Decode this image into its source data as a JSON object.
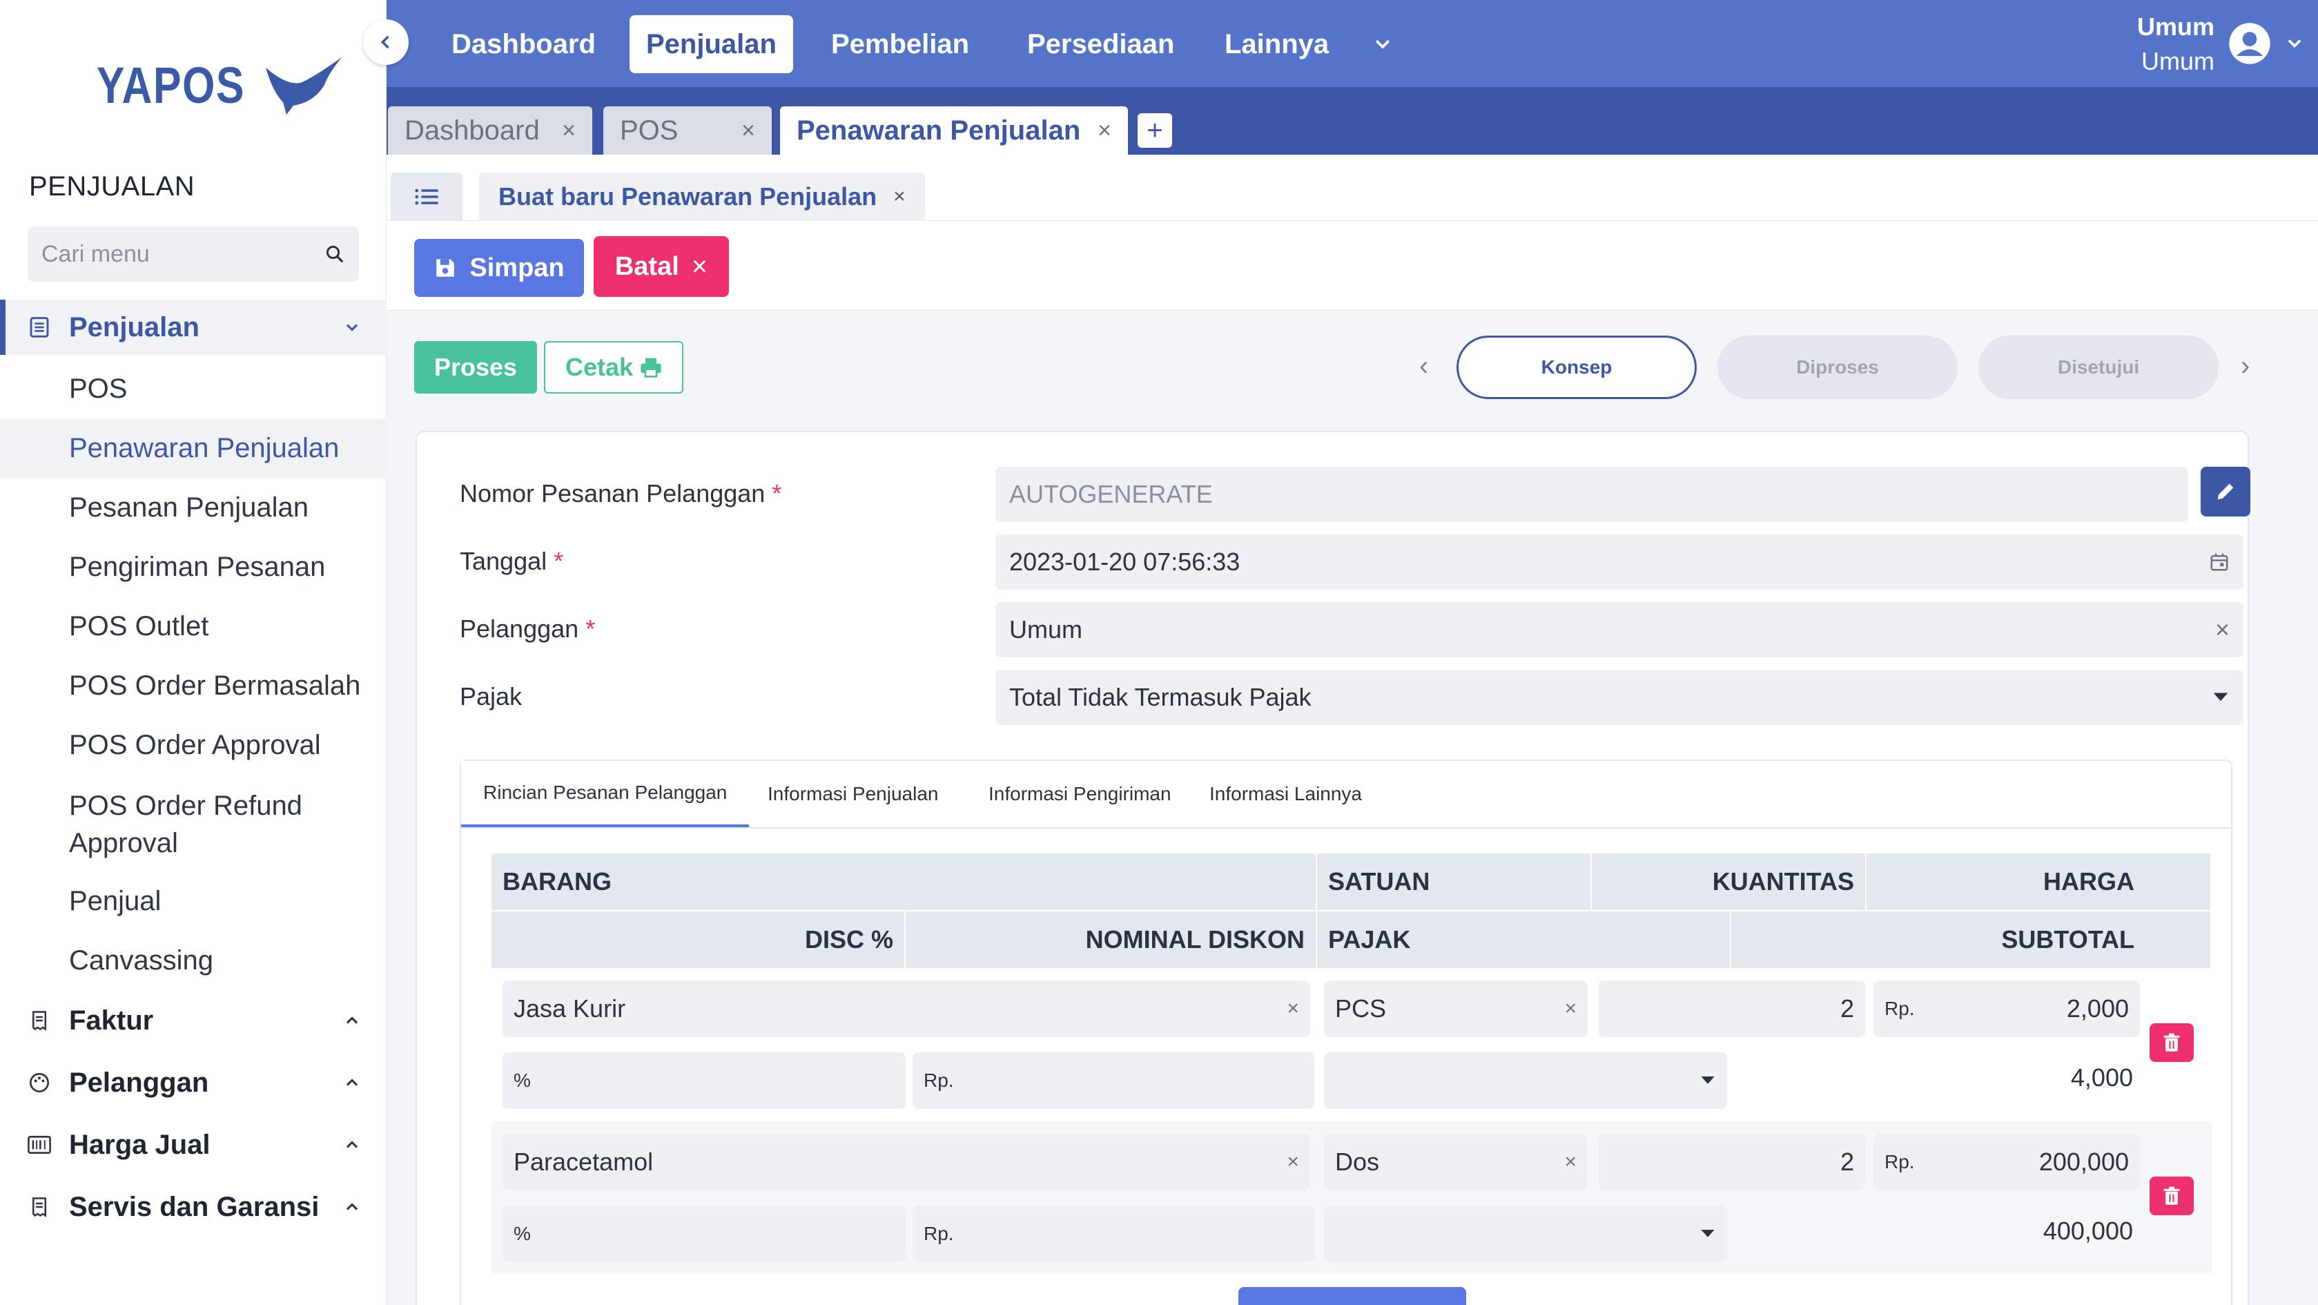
{
  "brand": {
    "name": "YAPOS",
    "color": "#3a5aa8"
  },
  "colors": {
    "primary": "#3b57a6",
    "topbar": "#5474c9",
    "success": "#48c29a",
    "danger": "#ee2f6e",
    "save": "#5877e2"
  },
  "sidebar": {
    "title": "PENJUALAN",
    "search_placeholder": "Cari menu",
    "groups": [
      {
        "label": "Penjualan",
        "icon": "document-list-icon",
        "expanded": true
      },
      {
        "label": "Faktur",
        "icon": "receipt-icon"
      },
      {
        "label": "Pelanggan",
        "icon": "palette-icon"
      },
      {
        "label": "Harga Jual",
        "icon": "barcode-icon"
      },
      {
        "label": "Servis dan Garansi",
        "icon": "receipt-icon"
      }
    ],
    "items": [
      {
        "label": "POS"
      },
      {
        "label": "Penawaran Penjualan",
        "selected": true
      },
      {
        "label": "Pesanan Penjualan"
      },
      {
        "label": "Pengiriman Pesanan"
      },
      {
        "label": "POS Outlet"
      },
      {
        "label": "POS Order Bermasalah"
      },
      {
        "label": "POS Order Approval"
      },
      {
        "label": "POS Order Refund Approval",
        "line1": "POS Order Refund",
        "line2": "Approval"
      },
      {
        "label": "Penjual"
      },
      {
        "label": "Canvassing"
      }
    ]
  },
  "topbar": {
    "nav": [
      "Dashboard",
      "Penjualan",
      "Pembelian",
      "Persediaan",
      "Lainnya"
    ],
    "active": "Penjualan",
    "user": {
      "name": "Umum",
      "role": "Umum"
    }
  },
  "doc_tabs": [
    {
      "label": "Dashboard"
    },
    {
      "label": "POS"
    },
    {
      "label": "Penawaran Penjualan",
      "active": true
    }
  ],
  "sub_tab": {
    "label": "Buat baru Penawaran Penjualan"
  },
  "actions": {
    "save": "Simpan",
    "cancel": "Batal",
    "process": "Proses",
    "print": "Cetak"
  },
  "steps": [
    "Konsep",
    "Diproses",
    "Disetujui"
  ],
  "form": {
    "order_number": {
      "label": "Nomor Pesanan Pelanggan",
      "placeholder": "AUTOGENERATE"
    },
    "date": {
      "label": "Tanggal",
      "value": "2023-01-20  07:56:33"
    },
    "customer": {
      "label": "Pelanggan",
      "value": "Umum"
    },
    "tax": {
      "label": "Pajak",
      "value": "Total Tidak Termasuk Pajak"
    }
  },
  "inner_tabs": [
    "Rincian Pesanan Pelanggan",
    "Informasi Penjualan",
    "Informasi Pengiriman",
    "Informasi Lainnya"
  ],
  "table": {
    "headers_row1": [
      "BARANG",
      "SATUAN",
      "KUANTITAS",
      "HARGA"
    ],
    "headers_row2": [
      "DISC %",
      "NOMINAL DISKON",
      "PAJAK",
      "SUBTOTAL"
    ],
    "rows": [
      {
        "item": "Jasa Kurir",
        "unit": "PCS",
        "qty": "2",
        "currency": "Rp.",
        "price": "2,000",
        "disc_pct": "%",
        "disc_cur": "Rp.",
        "subtotal": "4,000"
      },
      {
        "item": "Paracetamol",
        "unit": "Dos",
        "qty": "2",
        "currency": "Rp.",
        "price": "200,000",
        "disc_pct": "%",
        "disc_cur": "Rp.",
        "subtotal": "400,000"
      }
    ]
  }
}
